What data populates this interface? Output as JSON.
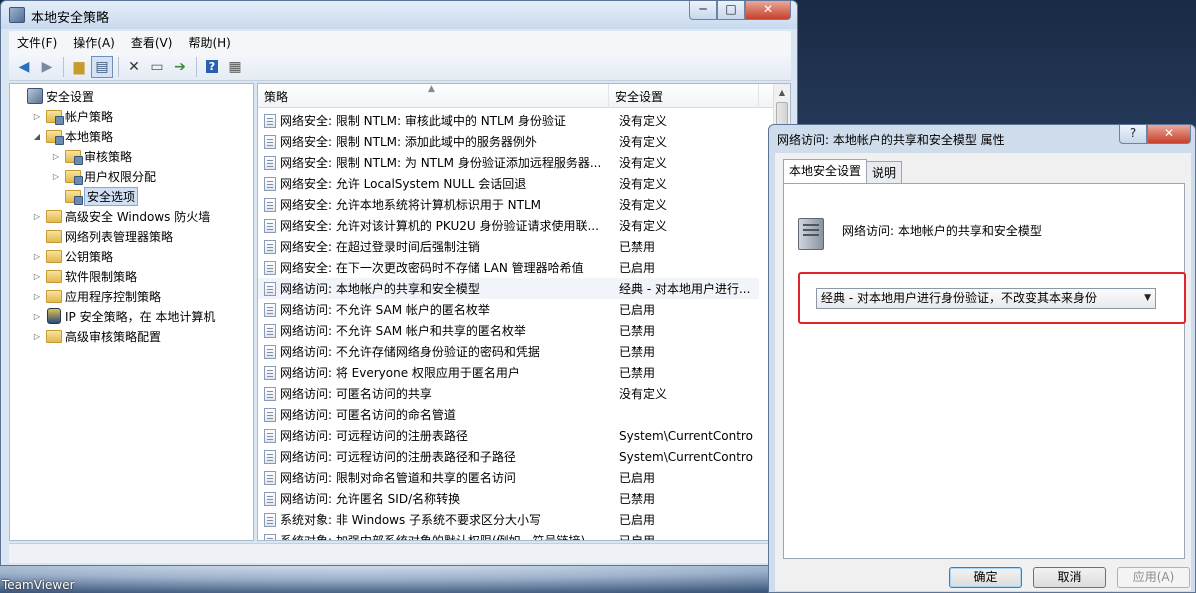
{
  "main_window": {
    "title": "本地安全策略",
    "controls": [
      "─",
      "□",
      "✕"
    ],
    "menu": [
      "文件(F)",
      "操作(A)",
      "查看(V)",
      "帮助(H)"
    ],
    "toolbar": [
      "back-icon",
      "forward-icon",
      "up-folder-icon",
      "show-tree-icon",
      "delete-icon",
      "properties-icon",
      "export-icon",
      "help-icon",
      "view-icon"
    ]
  },
  "tree": {
    "items": [
      {
        "label": "安全设置",
        "indent": 0,
        "arrow": "",
        "icon": "root",
        "selected": false
      },
      {
        "label": "帐户策略",
        "indent": 1,
        "arrow": "▷",
        "icon": "folder-lock",
        "selected": false
      },
      {
        "label": "本地策略",
        "indent": 1,
        "arrow": "◢",
        "icon": "folder-lock",
        "selected": false
      },
      {
        "label": "审核策略",
        "indent": 2,
        "arrow": "▷",
        "icon": "folder-lock",
        "selected": false
      },
      {
        "label": "用户权限分配",
        "indent": 2,
        "arrow": "▷",
        "icon": "folder-lock",
        "selected": false
      },
      {
        "label": "安全选项",
        "indent": 2,
        "arrow": "",
        "icon": "folder-lock",
        "selected": true
      },
      {
        "label": "高级安全 Windows 防火墙",
        "indent": 1,
        "arrow": "▷",
        "icon": "folder",
        "selected": false
      },
      {
        "label": "网络列表管理器策略",
        "indent": 1,
        "arrow": "",
        "icon": "folder",
        "selected": false
      },
      {
        "label": "公钥策略",
        "indent": 1,
        "arrow": "▷",
        "icon": "folder",
        "selected": false
      },
      {
        "label": "软件限制策略",
        "indent": 1,
        "arrow": "▷",
        "icon": "folder",
        "selected": false
      },
      {
        "label": "应用程序控制策略",
        "indent": 1,
        "arrow": "▷",
        "icon": "folder",
        "selected": false
      },
      {
        "label": "IP 安全策略，在 本地计算机",
        "indent": 1,
        "arrow": "▷",
        "icon": "ipsec",
        "selected": false
      },
      {
        "label": "高级审核策略配置",
        "indent": 1,
        "arrow": "▷",
        "icon": "folder",
        "selected": false
      }
    ]
  },
  "list": {
    "col_policy": "策略",
    "col_setting": "安全设置",
    "rows": [
      {
        "policy": "网络安全: 限制 NTLM: 审核此域中的 NTLM 身份验证",
        "setting": "没有定义"
      },
      {
        "policy": "网络安全: 限制 NTLM: 添加此域中的服务器例外",
        "setting": "没有定义"
      },
      {
        "policy": "网络安全: 限制 NTLM: 为 NTLM 身份验证添加远程服务器...",
        "setting": "没有定义"
      },
      {
        "policy": "网络安全: 允许 LocalSystem NULL 会话回退",
        "setting": "没有定义"
      },
      {
        "policy": "网络安全: 允许本地系统将计算机标识用于 NTLM",
        "setting": "没有定义"
      },
      {
        "policy": "网络安全: 允许对该计算机的 PKU2U 身份验证请求使用联...",
        "setting": "没有定义"
      },
      {
        "policy": "网络安全: 在超过登录时间后强制注销",
        "setting": "已禁用"
      },
      {
        "policy": "网络安全: 在下一次更改密码时不存储 LAN 管理器哈希值",
        "setting": "已启用"
      },
      {
        "policy": "网络访问: 本地帐户的共享和安全模型",
        "setting": "经典 - 对本地用户进行...",
        "selected": true
      },
      {
        "policy": "网络访问: 不允许 SAM 帐户的匿名枚举",
        "setting": "已启用"
      },
      {
        "policy": "网络访问: 不允许 SAM 帐户和共享的匿名枚举",
        "setting": "已禁用"
      },
      {
        "policy": "网络访问: 不允许存储网络身份验证的密码和凭据",
        "setting": "已禁用"
      },
      {
        "policy": "网络访问: 将 Everyone 权限应用于匿名用户",
        "setting": "已禁用"
      },
      {
        "policy": "网络访问: 可匿名访问的共享",
        "setting": "没有定义"
      },
      {
        "policy": "网络访问: 可匿名访问的命名管道",
        "setting": ""
      },
      {
        "policy": "网络访问: 可远程访问的注册表路径",
        "setting": "System\\CurrentContro..."
      },
      {
        "policy": "网络访问: 可远程访问的注册表路径和子路径",
        "setting": "System\\CurrentContro..."
      },
      {
        "policy": "网络访问: 限制对命名管道和共享的匿名访问",
        "setting": "已启用"
      },
      {
        "policy": "网络访问: 允许匿名 SID/名称转换",
        "setting": "已禁用"
      },
      {
        "policy": "系统对象: 非 Windows 子系统不要求区分大小写",
        "setting": "已启用"
      },
      {
        "policy": "系统对象: 加强内部系统对象的默认权限(例如，符号链接)",
        "setting": "已启用"
      }
    ]
  },
  "dialog": {
    "title": "网络访问: 本地帐户的共享和安全模型 属性",
    "controls": [
      "?",
      "✕"
    ],
    "tabs": [
      "本地安全设置",
      "说明"
    ],
    "setting_name": "网络访问: 本地帐户的共享和安全模型",
    "select_value": "经典 - 对本地用户进行身份验证，不改变其本来身份",
    "ok": "确定",
    "cancel": "取消",
    "apply": "应用(A)"
  },
  "desktop": {
    "teamviewer": "TeamViewer"
  }
}
